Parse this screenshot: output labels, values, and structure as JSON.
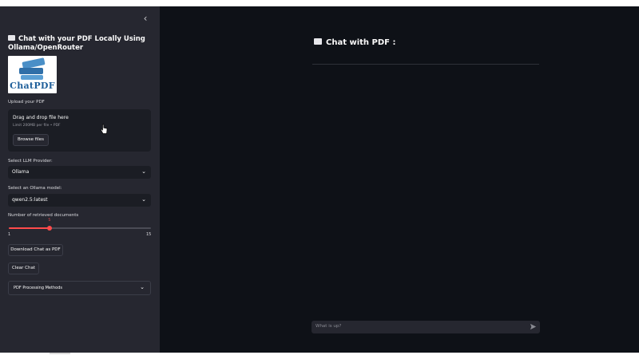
{
  "sidebar": {
    "collapse_icon": "chevron-left-icon",
    "title": "Chat with your PDF Locally Using Ollama/OpenRouter",
    "logo_text": "ChatPDF",
    "upload": {
      "label": "Upload your PDF",
      "drop_text": "Drag and drop file here",
      "limit_text": "Limit 200MB per file • PDF",
      "browse_label": "Browse files"
    },
    "provider": {
      "label": "Select LLM Provider:",
      "value": "Ollama"
    },
    "model": {
      "label": "Select an Ollama model:",
      "value": "qwen2.5:latest"
    },
    "docs_slider": {
      "label": "Number of retrieved documents",
      "value": "5",
      "min": "1",
      "max": "15",
      "fraction": 0.2857
    },
    "download_label": "Download Chat as PDF",
    "clear_label": "Clear Chat",
    "expander_label": "PDF Processing Methods"
  },
  "main": {
    "title": "Chat with PDF :",
    "input_placeholder": "What is up?"
  },
  "colors": {
    "background": "#0e1117",
    "sidebar": "#262730",
    "accent": "#ff4b4b"
  }
}
